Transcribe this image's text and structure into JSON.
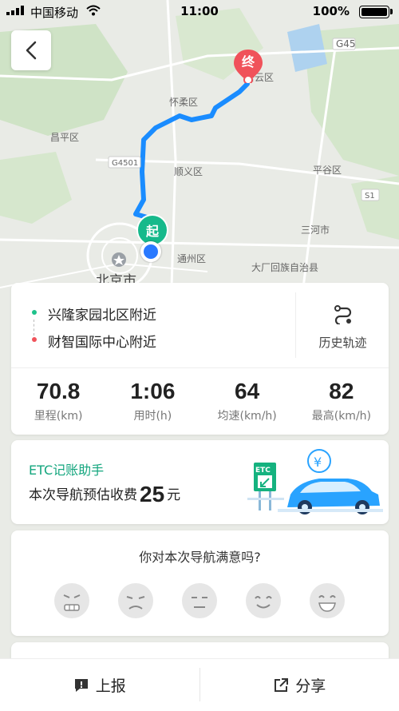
{
  "status_bar": {
    "carrier": "中国移动",
    "time": "11:00",
    "battery": "100%"
  },
  "map": {
    "place_labels": [
      "G45",
      "密云区",
      "怀柔区",
      "昌平区",
      "G4501",
      "顺义区",
      "平谷区",
      "S1",
      "三河市",
      "通州区",
      "大厂回族自治县",
      "北京市"
    ],
    "start_marker": "起",
    "end_marker": "终",
    "route_color": "#1a8cff"
  },
  "route": {
    "from": "兴隆家园北区附近",
    "to": "财智国际中心附近",
    "from_dot_color": "#1ec28b",
    "to_dot_color": "#f0525a",
    "history_label": "历史轨迹"
  },
  "stats": [
    {
      "value": "70.8",
      "label": "里程(km)"
    },
    {
      "value": "1:06",
      "label": "用时(h)"
    },
    {
      "value": "64",
      "label": "均速(km/h)"
    },
    {
      "value": "82",
      "label": "最高(km/h)"
    }
  ],
  "etc": {
    "title": "ETC记账助手",
    "fee_prefix": "本次导航预估收费",
    "fee_amount": "25",
    "fee_unit": "元",
    "sign_text": "ETC",
    "currency_symbol": "¥"
  },
  "feedback": {
    "title": "你对本次导航满意吗?",
    "emojis": [
      "very-unsatisfied-icon",
      "unsatisfied-icon",
      "neutral-icon",
      "satisfied-icon",
      "very-satisfied-icon"
    ]
  },
  "bottom_bar": {
    "report_label": "上报",
    "share_label": "分享"
  },
  "colors": {
    "accent_green": "#14a67e",
    "route_blue": "#1a8cff"
  }
}
